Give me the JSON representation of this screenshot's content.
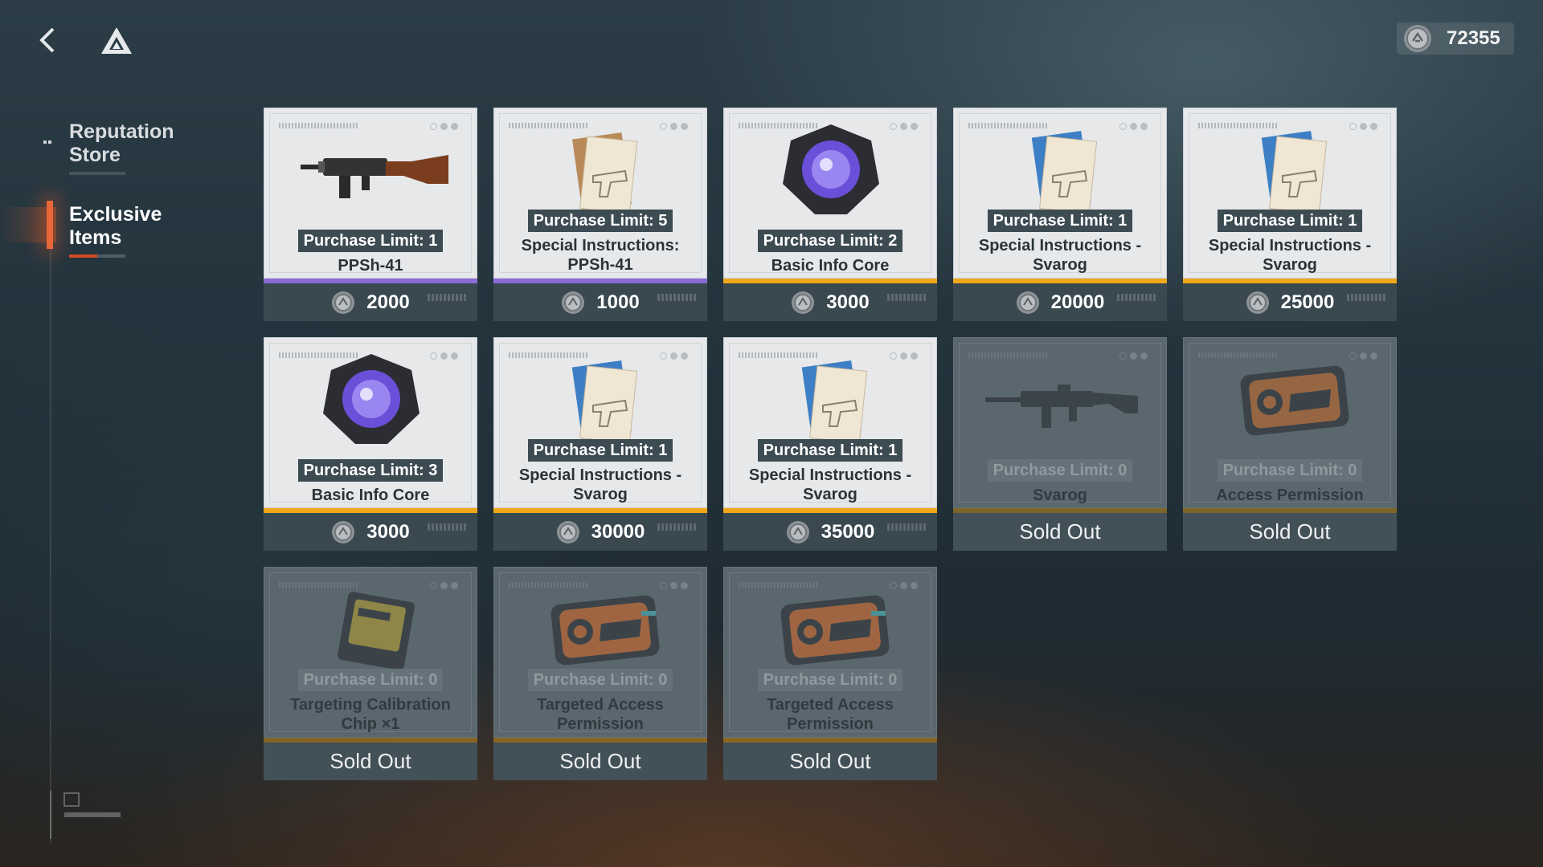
{
  "header": {
    "currency_amount": "72355",
    "back_icon": "chevron-left-icon",
    "logo_icon": "triangle-logo-icon",
    "coin_icon": "coin-icon"
  },
  "sidebar": {
    "items": [
      {
        "label": "Reputation Store",
        "active": false
      },
      {
        "label": "Exclusive Items",
        "active": true
      }
    ]
  },
  "colors": {
    "rarity_purple": "#8c6bd6",
    "rarity_gold": "#f0a818",
    "accent": "#e8663a"
  },
  "cards": [
    {
      "limit": "Purchase Limit: 1",
      "name": "PPSh-41",
      "price": "2000",
      "status": "",
      "icon": "smg-icon",
      "rarity": "purple"
    },
    {
      "limit": "Purchase Limit: 5",
      "name": "Special Instructions: PPSh-41",
      "price": "1000",
      "status": "",
      "icon": "blueprint-icon",
      "rarity": "purple"
    },
    {
      "limit": "Purchase Limit: 2",
      "name": "Basic Info Core",
      "price": "3000",
      "status": "",
      "icon": "info-core-icon",
      "rarity": "gold"
    },
    {
      "limit": "Purchase Limit: 1",
      "name": "Special Instructions - Svarog",
      "price": "20000",
      "status": "",
      "icon": "blueprint-icon",
      "rarity": "gold"
    },
    {
      "limit": "Purchase Limit: 1",
      "name": "Special Instructions - Svarog",
      "price": "25000",
      "status": "",
      "icon": "blueprint-icon",
      "rarity": "gold"
    },
    {
      "limit": "Purchase Limit: 3",
      "name": "Basic Info Core",
      "price": "3000",
      "status": "",
      "icon": "info-core-icon",
      "rarity": "gold"
    },
    {
      "limit": "Purchase Limit: 1",
      "name": "Special Instructions - Svarog",
      "price": "30000",
      "status": "",
      "icon": "blueprint-icon",
      "rarity": "gold"
    },
    {
      "limit": "Purchase Limit: 1",
      "name": "Special Instructions - Svarog",
      "price": "35000",
      "status": "",
      "icon": "blueprint-icon",
      "rarity": "gold"
    },
    {
      "limit": "Purchase Limit: 0",
      "name": "Svarog",
      "price": "",
      "status": "Sold Out",
      "icon": "rifle-icon",
      "rarity": "gold"
    },
    {
      "limit": "Purchase Limit: 0",
      "name": "Access Permission",
      "price": "",
      "status": "Sold Out",
      "icon": "access-card-icon",
      "rarity": "gold"
    },
    {
      "limit": "Purchase Limit: 0",
      "name": "Targeting Calibration Chip ×1",
      "price": "",
      "status": "Sold Out",
      "icon": "chip-icon",
      "rarity": "gold"
    },
    {
      "limit": "Purchase Limit: 0",
      "name": "Targeted Access Permission",
      "price": "",
      "status": "Sold Out",
      "icon": "access-card-icon",
      "rarity": "gold"
    },
    {
      "limit": "Purchase Limit: 0",
      "name": "Targeted Access Permission",
      "price": "",
      "status": "Sold Out",
      "icon": "access-card-icon",
      "rarity": "gold"
    }
  ]
}
